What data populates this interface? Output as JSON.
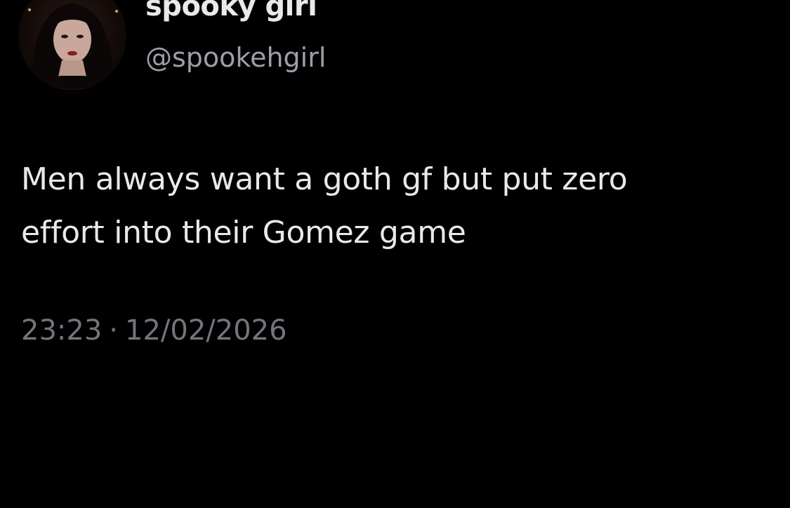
{
  "author": {
    "display_name": "spooky girl",
    "handle": "@spookehgirl",
    "avatar_icon": "profile-photo-avatar"
  },
  "tweet": {
    "text_lines": [
      "Men always want a goth gf but put zero",
      "effort into their Gomez game"
    ]
  },
  "meta": {
    "time": "23:23",
    "separator": "·",
    "date": "12/02/2026"
  },
  "colors": {
    "background": "#000000",
    "primary_text": "#e7e9ea",
    "secondary_text": "#71767b"
  }
}
